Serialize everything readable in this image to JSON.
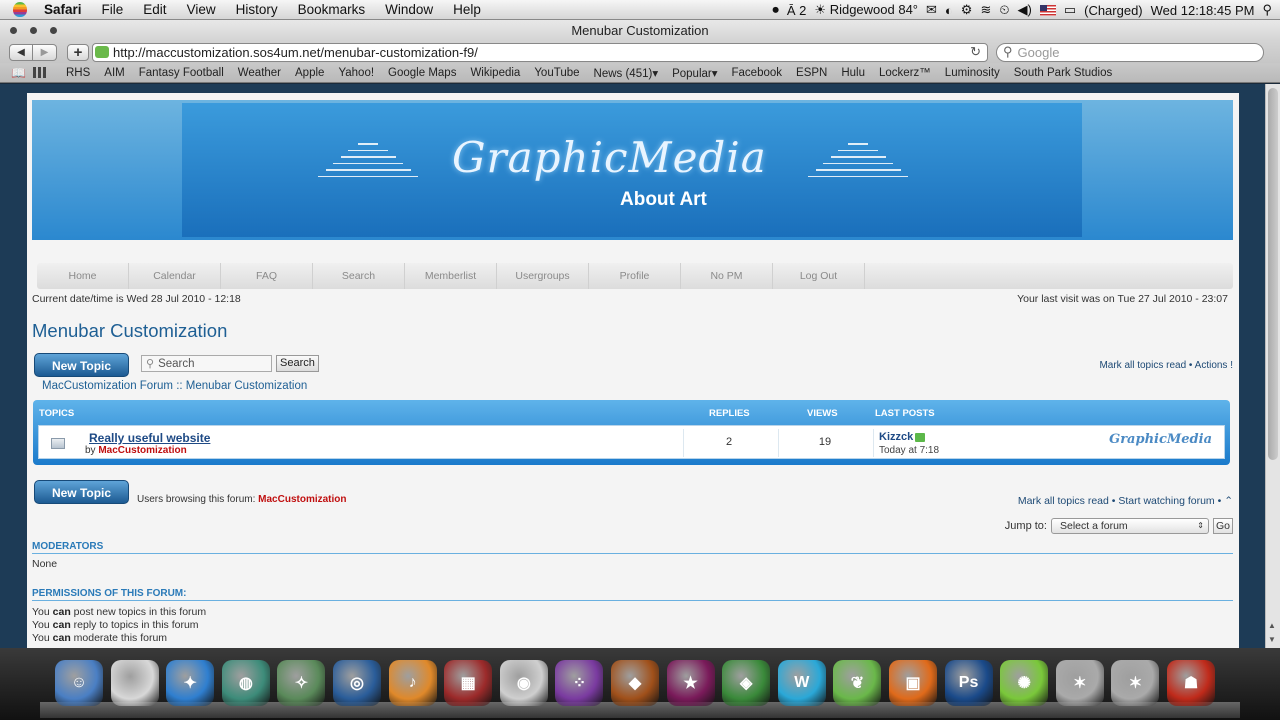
{
  "menubar": {
    "app": "Safari",
    "items": [
      "File",
      "Edit",
      "View",
      "History",
      "Bookmarks",
      "Window",
      "Help"
    ],
    "status": {
      "adobe_count": "2",
      "weather": "Ridgewood 84°",
      "battery": "(Charged)",
      "clock": "Wed 12:18:45 PM"
    }
  },
  "window": {
    "title": "Menubar Customization",
    "url": "http://maccustomization.sos4um.net/menubar-customization-f9/",
    "search_placeholder": "Google"
  },
  "bookmarks": [
    "RHS",
    "AIM",
    "Fantasy Football",
    "Weather",
    "Apple",
    "Yahoo!",
    "Google Maps",
    "Wikipedia",
    "YouTube",
    "News (451)▾",
    "Popular▾",
    "Facebook",
    "ESPN",
    "Hulu",
    "Lockerz™",
    "Luminosity",
    "South Park Studios"
  ],
  "banner": {
    "logo": "GraphicMedia",
    "tagline": "About Art"
  },
  "nav": [
    "Home",
    "Calendar",
    "FAQ",
    "Search",
    "Memberlist",
    "Usergroups",
    "Profile",
    "No PM",
    "Log Out"
  ],
  "forum": {
    "datetime": "Current date/time is Wed 28 Jul 2010 - 12:18",
    "last_visit": "Your last visit was on Tue 27 Jul 2010 - 23:07",
    "title": "Menubar Customization",
    "new_topic_label": "New Topic",
    "search_placeholder": "Search",
    "search_button": "Search",
    "top_actions": "Mark all topics read • Actions !",
    "breadcrumb": "MacCustomization Forum :: Menubar Customization",
    "headers": {
      "topics": "TOPICS",
      "replies": "REPLIES",
      "views": "VIEWS",
      "last_posts": "LAST POSTS"
    },
    "topic": {
      "title": "Really useful website",
      "by": "by",
      "author": "MacCustomization",
      "replies": "2",
      "views": "19",
      "last_user": "Kizzck",
      "last_time": "Today at 7:18",
      "logo": "GraphicMedia"
    },
    "browsing_label": "Users browsing this forum:",
    "browsing_user": "MacCustomization",
    "bottom_actions": "Mark all topics read • Start watching forum •",
    "jump_label": "Jump to:",
    "jump_select": "Select a forum",
    "jump_go": "Go",
    "moderators_title": "MODERATORS",
    "moderators_value": "None",
    "permissions_title": "PERMISSIONS OF THIS FORUM:",
    "permissions": [
      {
        "pre": "You",
        "can": "can",
        "post": "post new topics in this forum"
      },
      {
        "pre": "You",
        "can": "can",
        "post": "reply to topics in this forum"
      },
      {
        "pre": "You",
        "can": "can",
        "post": "moderate this forum"
      }
    ]
  },
  "dock": [
    {
      "name": "finder",
      "color": "#4a7fc4"
    },
    {
      "name": "apple",
      "color": "#d8d8d8"
    },
    {
      "name": "safari",
      "color": "#2f7fd0"
    },
    {
      "name": "turtle",
      "color": "#3d8c7a"
    },
    {
      "name": "compass",
      "color": "#5a8a5a"
    },
    {
      "name": "globe",
      "color": "#2a5d9a"
    },
    {
      "name": "itunes-ipod",
      "color": "#e0892a"
    },
    {
      "name": "photo-booth",
      "color": "#9c2a2a"
    },
    {
      "name": "webcam",
      "color": "#cfcfcf"
    },
    {
      "name": "front-row",
      "color": "#7a3aa0"
    },
    {
      "name": "game",
      "color": "#a0501a"
    },
    {
      "name": "star-4",
      "color": "#7a1a5a"
    },
    {
      "name": "sims",
      "color": "#3a8a3a"
    },
    {
      "name": "word-w",
      "color": "#2aa8d8"
    },
    {
      "name": "leaf",
      "color": "#6ab84a"
    },
    {
      "name": "slides",
      "color": "#e06a1a"
    },
    {
      "name": "photoshop",
      "color": "#1a4a8a"
    },
    {
      "name": "limewire",
      "color": "#7ac83a"
    },
    {
      "name": "imovie",
      "color": "#aaaaaa"
    },
    {
      "name": "imovie-2",
      "color": "#aaaaaa"
    },
    {
      "name": "ninja",
      "color": "#c02a1a"
    }
  ]
}
